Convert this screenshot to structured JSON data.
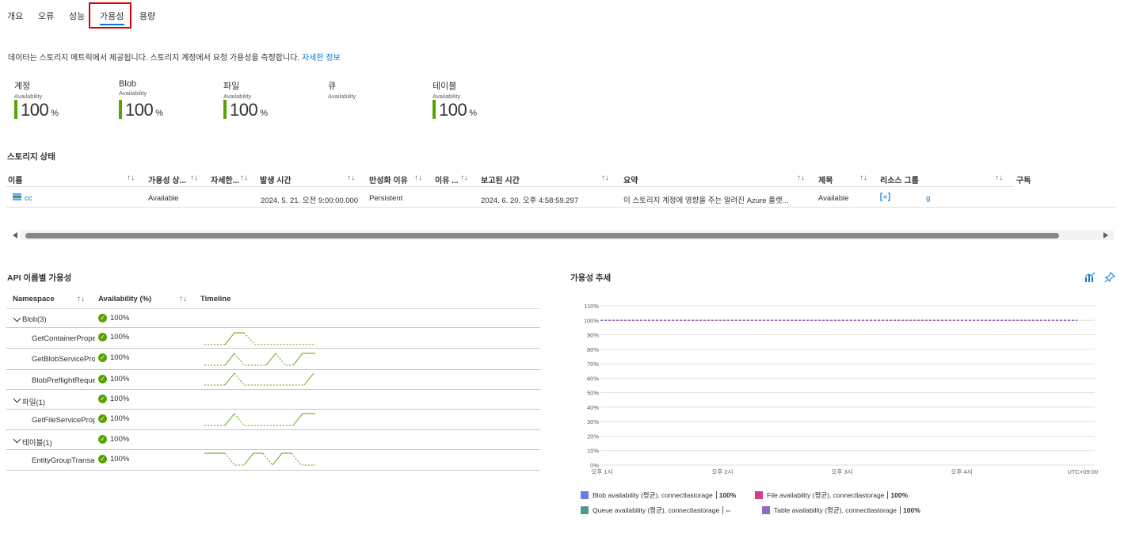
{
  "tabs": [
    {
      "label": "개요"
    },
    {
      "label": "오류"
    },
    {
      "label": "성능"
    },
    {
      "label": "가용성"
    },
    {
      "label": "용량"
    }
  ],
  "description": {
    "text": "데이터는 스토리지 메트릭에서 제공됩니다. 스토리지 계정에서 요청 가용성을 측정합니다.",
    "link": "자세한 정보"
  },
  "tiles": [
    {
      "title": "계정",
      "sub": "Availability",
      "value": "100",
      "unit": "%",
      "color": "#57a300"
    },
    {
      "title": "Blob",
      "sub": "Availability",
      "value": "100",
      "unit": "%",
      "color": "#57a300"
    },
    {
      "title": "파일",
      "sub": "Availability",
      "value": "100",
      "unit": "%",
      "color": "#57a300"
    },
    {
      "title": "큐",
      "sub": "Availability",
      "value": "",
      "unit": ""
    },
    {
      "title": "테이블",
      "sub": "Availability",
      "value": "100",
      "unit": "%",
      "color": "#57a300"
    }
  ],
  "storage_status": {
    "title": "스토리지 상태",
    "columns": [
      "이름",
      "가용성 상...",
      "자세한...",
      "발생 시간",
      "만성화 이유",
      "이유 ...",
      "보고된 시간",
      "요약",
      "제목",
      "리소스 그룹",
      "구독"
    ],
    "row": {
      "name": "cc",
      "availability": "Available",
      "occurred": "2024. 5. 21. 오전 9:00:00.000",
      "reason": "Persistent",
      "reported": "2024. 6. 20. 오후 4:58:59.297",
      "summary": "이 스토리지 계정에 영향을 주는 알려진 Azure 플랫...",
      "title": "Available",
      "resource_group": "g"
    }
  },
  "api_section": {
    "title": "API 이름별 가용성",
    "columns": {
      "namespace": "Namespace",
      "availability": "Availability (%)",
      "timeline": "Timeline"
    },
    "rows": [
      {
        "name": "Blob",
        "count": "(3)",
        "value": "100%",
        "group": true
      },
      {
        "name": "GetContainerProperties",
        "value": "100%",
        "group": false
      },
      {
        "name": "GetBlobServiceProperties",
        "value": "100%",
        "group": false
      },
      {
        "name": "BlobPreflightRequest",
        "value": "100%",
        "group": false
      },
      {
        "name": "파일",
        "count": "(1)",
        "value": "100%",
        "group": true
      },
      {
        "name": "GetFileServiceProperties",
        "value": "100%",
        "group": false
      },
      {
        "name": "테이블",
        "count": "(1)",
        "value": "100%",
        "group": true
      },
      {
        "name": "EntityGroupTransaction",
        "value": "100%",
        "group": false
      }
    ]
  },
  "trend": {
    "title": "가용성 추세",
    "timezone": "UTC+09:00"
  },
  "chart_data": {
    "type": "line",
    "title": "가용성 추세",
    "x": [
      "오후 1시",
      "오후 2시",
      "오후 3시",
      "오후 4시"
    ],
    "y_ticks": [
      "110%",
      "100%",
      "90%",
      "80%",
      "70%",
      "60%",
      "50%",
      "40%",
      "30%",
      "20%",
      "10%",
      "0%"
    ],
    "ylim": [
      0,
      110
    ],
    "grid": true,
    "series": [
      {
        "name": "Blob availability (평균), connectlastorage",
        "summary": "100%",
        "color": "#6b7ee0",
        "value": 100
      },
      {
        "name": "File availability (평균), connectlastorage",
        "summary": "100%",
        "color": "#d13e8c",
        "value": 100
      },
      {
        "name": "Queue availability (평균), connectlastorage",
        "summary": "--",
        "color": "#4a9a94",
        "value": null
      },
      {
        "name": "Table availability (평균), connectlastorage",
        "summary": "100%",
        "color": "#8f6ac0",
        "value": 100
      }
    ]
  }
}
